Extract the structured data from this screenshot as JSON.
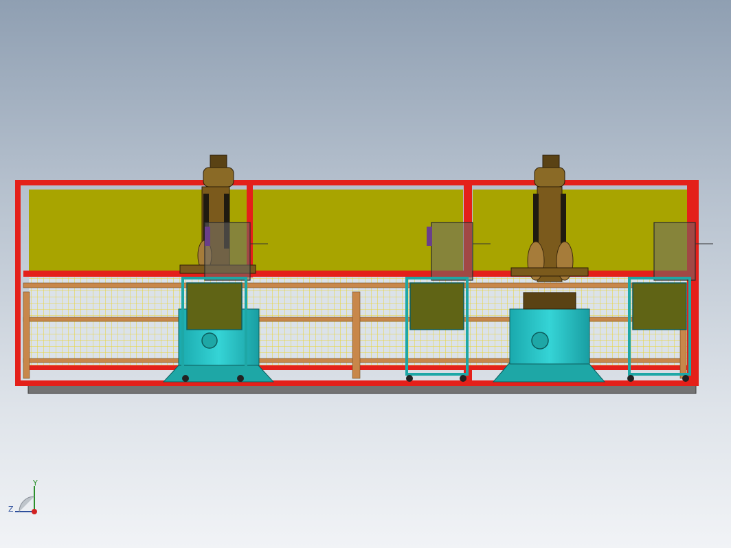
{
  "viewport": {
    "background_top": "#8f9fb2",
    "background_bottom": "#f1f3f6"
  },
  "scene": {
    "colors": {
      "frame": "#e4201a",
      "panel": "#a8a400",
      "mesh": "#e9d430",
      "cart": "#1ea7a6",
      "cart_panel": "#606415",
      "pedestal": "#26c3c6",
      "robot": "#7b5a1c",
      "rail": "#c8874a",
      "floor": "#737373"
    }
  },
  "triad": {
    "y_label": "Y",
    "z_label": "Z",
    "y_color": "#2a8f2a",
    "z_color": "#2d4f9c",
    "x_color": "#d22222"
  }
}
